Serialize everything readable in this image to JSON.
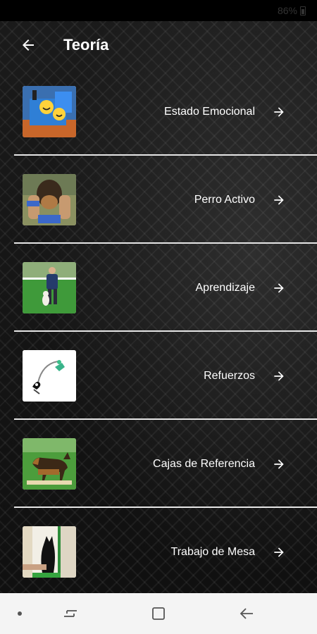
{
  "status_bar": {
    "battery_text": "86%",
    "battery_icon": "battery-icon"
  },
  "app_bar": {
    "title": "Teoría",
    "back_icon": "arrow-back-icon"
  },
  "items": [
    {
      "label": "Estado Emocional",
      "thumb_icon": "emotional-state-image"
    },
    {
      "label": "Perro Activo",
      "thumb_icon": "active-dog-image"
    },
    {
      "label": "Aprendizaje",
      "thumb_icon": "learning-image"
    },
    {
      "label": "Refuerzos",
      "thumb_icon": "reinforcements-image"
    },
    {
      "label": "Cajas de Referencia",
      "thumb_icon": "reference-boxes-image"
    },
    {
      "label": "Trabajo de Mesa",
      "thumb_icon": "table-work-image"
    }
  ],
  "nav_bar": {
    "buttons": [
      "dot-icon",
      "recent-apps-icon",
      "home-icon",
      "back-icon"
    ]
  },
  "colors": {
    "background": "#141414",
    "divider": "#e6e6e6",
    "text": "#ffffff",
    "nav_bar": "#f4f4f4"
  }
}
